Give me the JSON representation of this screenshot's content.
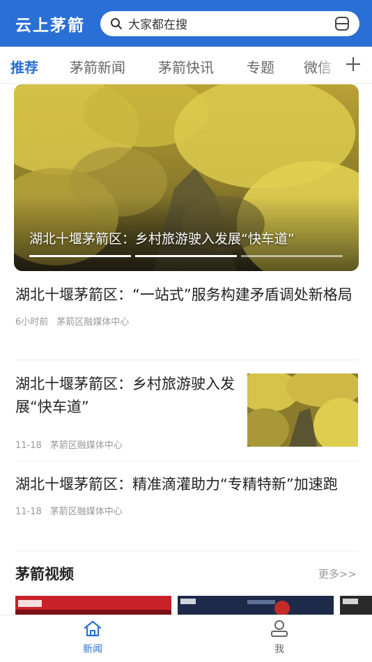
{
  "header": {
    "app_title": "云上茅箭",
    "search_placeholder": "大家都在搜",
    "brand_color": "#2a6fd6"
  },
  "tabs": [
    {
      "label": "推荐",
      "active": true
    },
    {
      "label": "茅箭新闻",
      "active": false
    },
    {
      "label": "茅箭快讯",
      "active": false
    },
    {
      "label": "专题",
      "active": false
    },
    {
      "label": "微信",
      "active": false
    }
  ],
  "hero": {
    "caption": "湖北十堰茅箭区：乡村旅游驶入发展“快车道”",
    "slide_count": 3,
    "active_slide": 1
  },
  "news": [
    {
      "title": "湖北十堰茅箭区：“一站式”服务构建矛盾调处新格局",
      "time": "6小时前",
      "source": "茅箭区融媒体中心"
    },
    {
      "title": "湖北十堰茅箭区：乡村旅游驶入发展“快车道”",
      "time": "11-18",
      "source": "茅箭区融媒体中心"
    },
    {
      "title": "湖北十堰茅箭区：精准滴灌助力“专精特新”加速跑",
      "time": "11-18",
      "source": "茅箭区融媒体中心"
    }
  ],
  "video_section": {
    "title": "茅箭视频",
    "more": "更多>>"
  },
  "tabbar": [
    {
      "label": "新闻",
      "icon": "home-icon",
      "active": true
    },
    {
      "label": "我",
      "icon": "user-icon",
      "active": false
    }
  ]
}
